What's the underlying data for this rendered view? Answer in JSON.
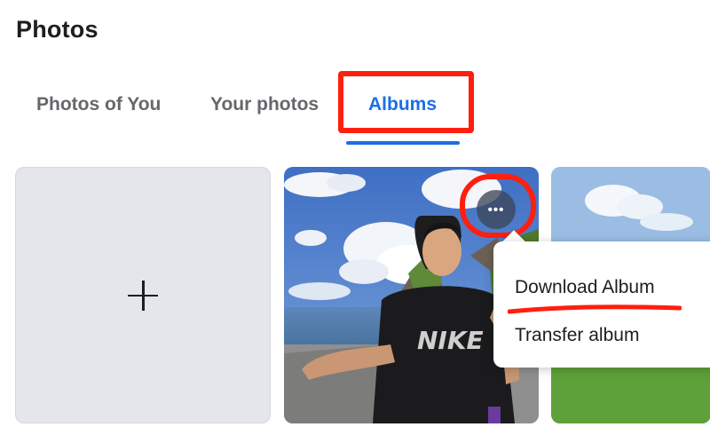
{
  "page": {
    "title": "Photos"
  },
  "tabs": [
    {
      "label": "Photos of You"
    },
    {
      "label": "Your photos"
    },
    {
      "label": "Albums"
    }
  ],
  "active_tab": "Albums",
  "albums": {
    "create_icon": "plus-icon",
    "more_icon": "more-horizontal-icon",
    "more_glyph": "•••",
    "menu_items": [
      {
        "label": "Download Album"
      },
      {
        "label": "Transfer album"
      }
    ]
  },
  "annotations": {
    "highlight_color": "#ff1f0f"
  },
  "colors": {
    "accent": "#1b6fe4",
    "tab_inactive": "#65676b",
    "card_bg": "#e4e6eb"
  }
}
